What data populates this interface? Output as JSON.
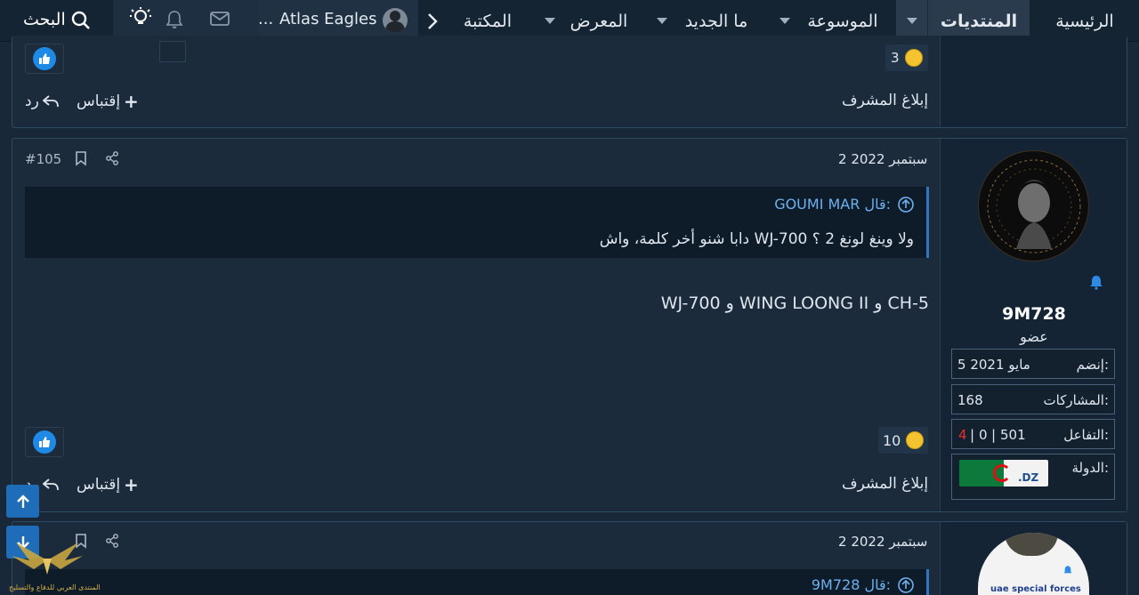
{
  "nav": {
    "home": "الرئيسية",
    "forums": "المنتديات",
    "encyclopedia": "الموسوعة",
    "whats_new": "ما الجديد",
    "gallery": "المعرض",
    "library": "المكتبة",
    "user_name": "Atlas Eagles",
    "user_more": "...",
    "search": "البحث"
  },
  "prev_post": {
    "reaction_count": "3",
    "report": "إبلاغ المشرف",
    "quote": "إقتباس",
    "reply": "رد"
  },
  "post105": {
    "date": "2 سبتمبر 2022",
    "number": "#105",
    "quote_author": "GOUMI MAR قال:",
    "quote_text": "دابا شنو أخر كلمة، واش WJ-700 ولا وينغ لونغ 2 ؟",
    "body": "WJ-700 و WING LOONG II و CH-5",
    "reaction_count": "10",
    "report": "إبلاغ المشرف",
    "quote": "إقتباس",
    "reply": "رد",
    "user": {
      "name": "9M728",
      "role": "عضو",
      "joined_label": "إنضم:",
      "joined_value": "5 مايو 2021",
      "posts_label": "المشاركات:",
      "posts_value": "168",
      "reaction_label": "التفاعل:",
      "reaction_positive": "501",
      "reaction_neutral": "0",
      "reaction_negative": "4",
      "sep": "|",
      "country_label": "الدولة:",
      "flag_text": ".DZ"
    }
  },
  "next_post": {
    "date": "2 سبتمبر 2022",
    "quote_author": "9M728 قال:",
    "avatar_text": "uae special forces"
  },
  "footer_logo_text": "المنتدى العربي للدفاع والتسليح",
  "colors": {
    "accent": "#2f76c4",
    "like": "#1e8ae6",
    "negative": "#e0322f"
  }
}
